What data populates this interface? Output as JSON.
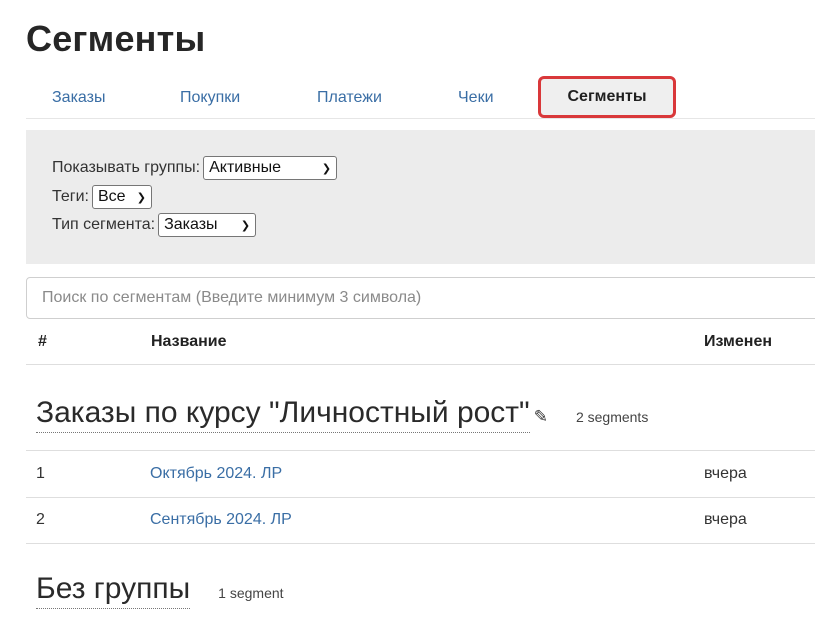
{
  "page": {
    "title": "Сегменты"
  },
  "tabs": [
    {
      "label": "Заказы"
    },
    {
      "label": "Покупки"
    },
    {
      "label": "Платежи"
    },
    {
      "label": "Чеки"
    },
    {
      "label": "Сегменты",
      "active": true
    }
  ],
  "filters": {
    "groups_label": "Показывать группы:",
    "groups_value": "Активные",
    "tags_label": "Теги:",
    "tags_value": "Все",
    "type_label": "Тип сегмента:",
    "type_value": "Заказы"
  },
  "search": {
    "placeholder": "Поиск по сегментам (Введите минимум 3 символа)",
    "value": ""
  },
  "table": {
    "columns": [
      "#",
      "Название",
      "Изменен"
    ]
  },
  "groups": [
    {
      "title": "Заказы по курсу \"Личностный рост\"",
      "count": "2 segments",
      "rows": [
        {
          "num": "1",
          "name": "Октябрь 2024. ЛР",
          "modified": "вчера"
        },
        {
          "num": "2",
          "name": "Сентябрь 2024. ЛР",
          "modified": "вчера"
        }
      ]
    },
    {
      "title": "Без группы",
      "count": "1 segment",
      "rows": []
    }
  ],
  "colors": {
    "link": "#3a6ea5",
    "highlight": "#d9383a",
    "filter_bg": "#ececec"
  },
  "icons": {
    "edit": "pencil-icon",
    "dropdown": "chevron-down-icon"
  }
}
